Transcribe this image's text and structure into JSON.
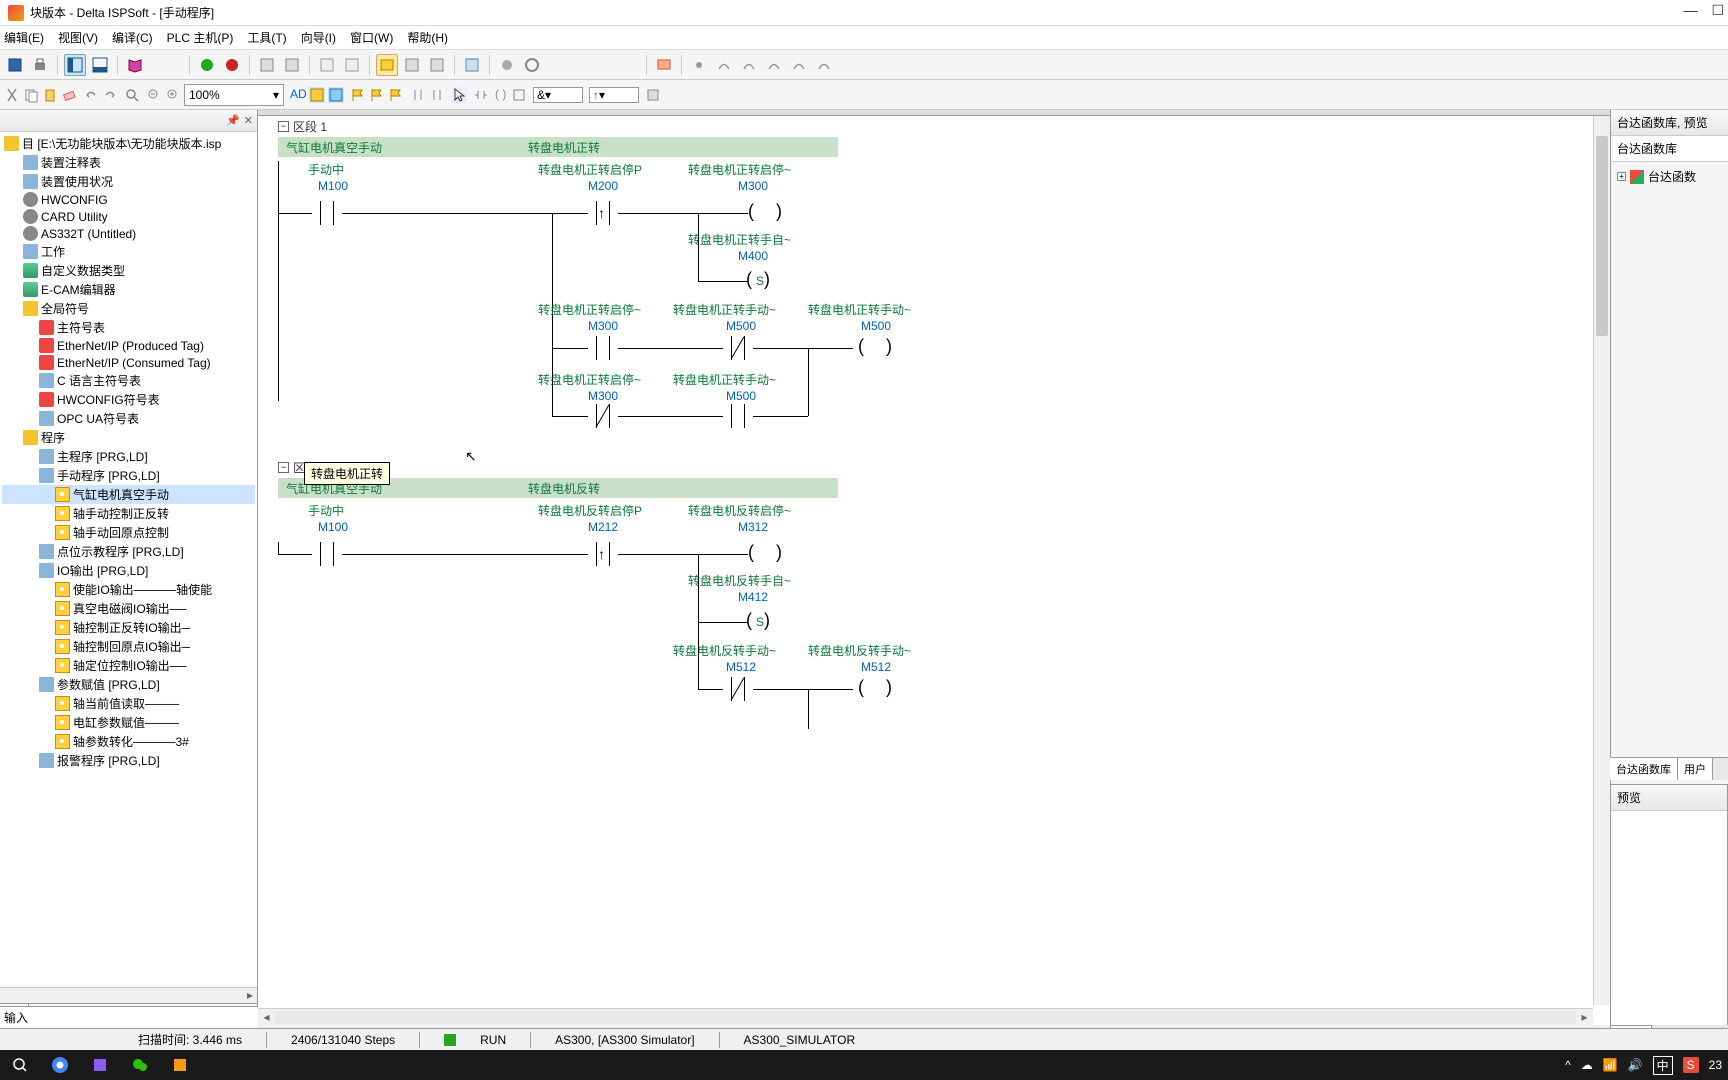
{
  "title": "块版本 - Delta ISPSoft - [手动程序]",
  "menu": [
    "编辑(E)",
    "视图(V)",
    "编译(C)",
    "PLC 主机(P)",
    "工具(T)",
    "向导(I)",
    "窗口(W)",
    "帮助(H)"
  ],
  "zoom": "100%",
  "tree": {
    "root": "目 [E:\\无功能块版本\\无功能块版本.isp",
    "items": [
      {
        "t": "装置注释表",
        "ico": "file",
        "ind": 1
      },
      {
        "t": "装置使用状况",
        "ico": "file",
        "ind": 1
      },
      {
        "t": "HWCONFIG",
        "ico": "gear",
        "ind": 1
      },
      {
        "t": "CARD Utility",
        "ico": "gear",
        "ind": 1
      },
      {
        "t": "AS332T  (Untitled)",
        "ico": "gear",
        "ind": 1
      },
      {
        "t": "工作",
        "ico": "file",
        "ind": 1
      },
      {
        "t": "自定义数据类型",
        "ico": "db",
        "ind": 1
      },
      {
        "t": "E-CAM编辑器",
        "ico": "db",
        "ind": 1
      },
      {
        "t": "全局符号",
        "ico": "folder",
        "ind": 1
      },
      {
        "t": "主符号表",
        "ico": "red",
        "ind": 2
      },
      {
        "t": "EtherNet/IP (Produced Tag)",
        "ico": "red",
        "ind": 2
      },
      {
        "t": "EtherNet/IP (Consumed Tag)",
        "ico": "red",
        "ind": 2
      },
      {
        "t": "C 语言主符号表",
        "ico": "file",
        "ind": 2
      },
      {
        "t": "HWCONFIG符号表",
        "ico": "red",
        "ind": 2
      },
      {
        "t": "OPC UA符号表",
        "ico": "file",
        "ind": 2
      },
      {
        "t": "程序",
        "ico": "folder",
        "ind": 1
      },
      {
        "t": "主程序 [PRG,LD]",
        "ico": "file",
        "ind": 2
      },
      {
        "t": "手动程序 [PRG,LD]",
        "ico": "file",
        "ind": 2
      },
      {
        "t": "气缸电机真空手动",
        "ico": "prg",
        "ind": 3,
        "sel": true
      },
      {
        "t": "轴手动控制正反转",
        "ico": "prg",
        "ind": 3
      },
      {
        "t": "轴手动回原点控制",
        "ico": "prg",
        "ind": 3
      },
      {
        "t": "点位示教程序 [PRG,LD]",
        "ico": "file",
        "ind": 2
      },
      {
        "t": "IO输出 [PRG,LD]",
        "ico": "file",
        "ind": 2
      },
      {
        "t": "使能IO输出─────轴使能",
        "ico": "prg",
        "ind": 3
      },
      {
        "t": "真空电磁阀IO输出──",
        "ico": "prg",
        "ind": 3
      },
      {
        "t": "轴控制正反转IO输出─",
        "ico": "prg",
        "ind": 3
      },
      {
        "t": "轴控制回原点IO输出─",
        "ico": "prg",
        "ind": 3
      },
      {
        "t": "轴定位控制IO输出──",
        "ico": "prg",
        "ind": 3
      },
      {
        "t": "参数赋值 [PRG,LD]",
        "ico": "file",
        "ind": 2
      },
      {
        "t": "轴当前值读取────",
        "ico": "prg",
        "ind": 3
      },
      {
        "t": "电缸参数赋值────",
        "ico": "prg",
        "ind": 3
      },
      {
        "t": "轴参数转化─────3#",
        "ico": "prg",
        "ind": 3
      },
      {
        "t": "报警程序 [PRG,LD]",
        "ico": "file",
        "ind": 2
      }
    ]
  },
  "sidebar_tab": "区",
  "input_label": "输入",
  "section1": {
    "num": "区段 1",
    "bar_left": "气缸电机真空手动",
    "bar_right": "转盘电机正转",
    "tooltip": "转盘电机正转",
    "labels": {
      "l1": "手动中",
      "a1": "M100",
      "l2": "转盘电机正转启停P",
      "a2": "M200",
      "l3": "转盘电机正转启停~",
      "a3": "M300",
      "l4": "转盘电机正转手自~",
      "a4": "M400",
      "l5": "转盘电机正转启停~",
      "a5": "M300",
      "l6": "转盘电机正转手动~",
      "a6": "M500",
      "l7": "转盘电机正转手动~",
      "a7": "M500",
      "l8": "转盘电机正转启停~",
      "a8": "M300",
      "l9": "转盘电机正转手动~",
      "a9": "M500",
      "s": "S"
    }
  },
  "section2": {
    "num": "区段 2",
    "bar_left": "气缸电机真空手动",
    "bar_right": "转盘电机反转",
    "labels": {
      "l1": "手动中",
      "a1": "M100",
      "l2": "转盘电机反转启停P",
      "a2": "M212",
      "l3": "转盘电机反转启停~",
      "a3": "M312",
      "l4": "转盘电机反转手自~",
      "a4": "M412",
      "l6": "转盘电机反转手动~",
      "a6": "M512",
      "l7": "转盘电机反转手动~",
      "a7": "M512",
      "s": "S"
    }
  },
  "right": {
    "hdr1": "台达函数库, 预览",
    "hdr2": "台达函数库",
    "item": "台达函数",
    "tab1": "台达函数库",
    "tab2": "用户",
    "preview": "预览",
    "preview_tab": "预览"
  },
  "status": {
    "scan": "扫描时间:  3.446 ms",
    "steps": "2406/131040 Steps",
    "run": "RUN",
    "model": "AS300, [AS300 Simulator]",
    "sim": "AS300_SIMULATOR"
  },
  "taskbar": {
    "time": "23",
    "ime": "中"
  }
}
